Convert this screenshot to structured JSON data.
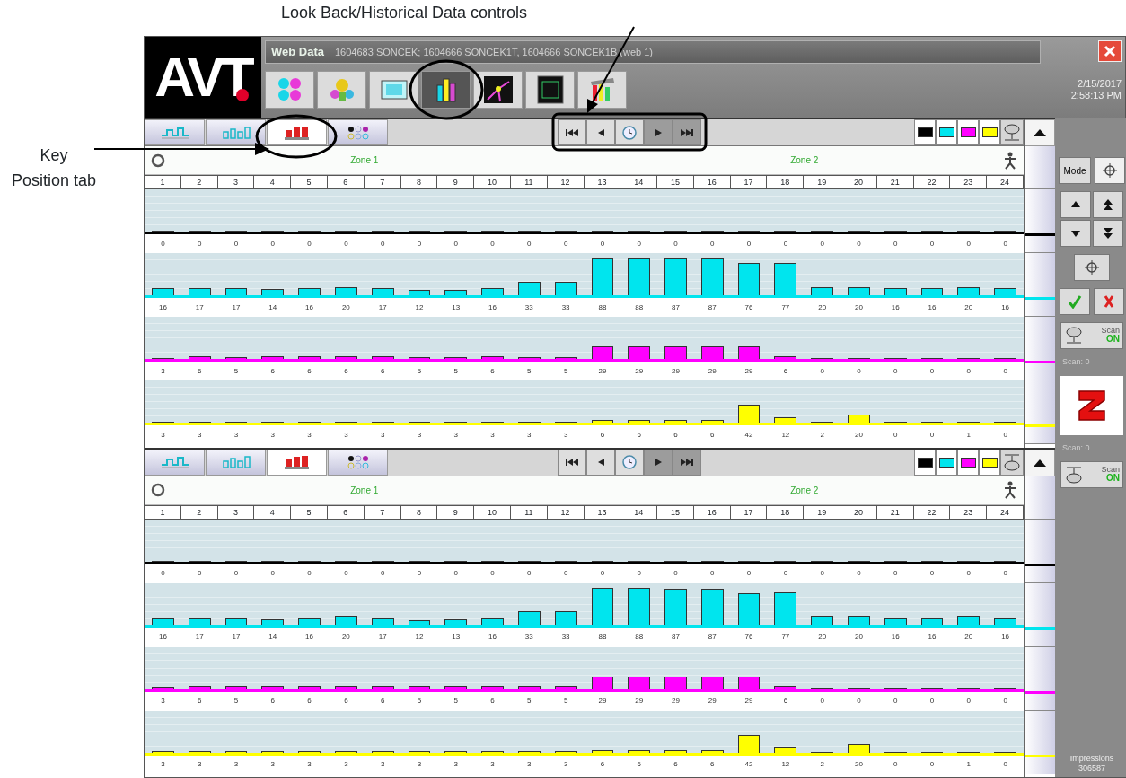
{
  "annotations": [
    {
      "kind": "top",
      "text": "Look Back/Historical Data controls"
    },
    {
      "kind": "left",
      "text": "Key Position tab"
    }
  ],
  "window": {
    "logo": "AVT",
    "app": "Web Data",
    "title": "1604683 SONCEK; 1604666 SONCEK1T, 1604666 SONCEK1B (web 1)",
    "date": "2/15/2017",
    "time": "2:58:13 PM"
  },
  "toolbar": [
    {
      "kind": "inks",
      "selected": false
    },
    {
      "kind": "flowers",
      "selected": false
    },
    {
      "kind": "film",
      "selected": false
    },
    {
      "kind": "bars",
      "selected": true
    },
    {
      "kind": "graph",
      "selected": false
    },
    {
      "kind": "frame",
      "selected": false
    },
    {
      "kind": "tools",
      "selected": false
    }
  ],
  "panels": [
    {
      "tabs": [
        {
          "kind": "line",
          "selected": false
        },
        {
          "kind": "outline",
          "selected": false
        },
        {
          "kind": "keys",
          "selected": true
        },
        {
          "kind": "dots",
          "selected": false
        }
      ],
      "nav": [
        {
          "kind": "first",
          "disabled": false
        },
        {
          "kind": "prev",
          "disabled": false
        },
        {
          "kind": "clock",
          "disabled": false
        },
        {
          "kind": "next",
          "disabled": true
        },
        {
          "kind": "last",
          "disabled": true
        }
      ],
      "swatches": [
        {
          "color": "#000000"
        },
        {
          "color": "#00e5ee"
        },
        {
          "color": "#ff00ff"
        },
        {
          "color": "#ffff00"
        }
      ],
      "key": {
        "kind": "top"
      },
      "zones": [
        "Zone 1",
        "Zone 2"
      ],
      "keys": [
        "1",
        "2",
        "3",
        "4",
        "5",
        "6",
        "7",
        "8",
        "9",
        "10",
        "11",
        "12",
        "13",
        "14",
        "15",
        "16",
        "17",
        "18",
        "19",
        "20",
        "21",
        "22",
        "23",
        "24"
      ],
      "lanes": [
        {
          "color": "#000000",
          "keys": [
            {
              "reading": "0",
              "level": 0
            },
            {
              "reading": "0",
              "level": 0
            },
            {
              "reading": "0",
              "level": 0
            },
            {
              "reading": "0",
              "level": 0
            },
            {
              "reading": "0",
              "level": 0
            },
            {
              "reading": "0",
              "level": 0
            },
            {
              "reading": "0",
              "level": 0
            },
            {
              "reading": "0",
              "level": 0
            },
            {
              "reading": "0",
              "level": 0
            },
            {
              "reading": "0",
              "level": 0
            },
            {
              "reading": "0",
              "level": 0
            },
            {
              "reading": "0",
              "level": 0
            },
            {
              "reading": "0",
              "level": 0
            },
            {
              "reading": "0",
              "level": 0
            },
            {
              "reading": "0",
              "level": 0
            },
            {
              "reading": "0",
              "level": 0
            },
            {
              "reading": "0",
              "level": 0
            },
            {
              "reading": "0",
              "level": 0
            },
            {
              "reading": "0",
              "level": 0
            },
            {
              "reading": "0",
              "level": 0
            },
            {
              "reading": "0",
              "level": 0
            },
            {
              "reading": "0",
              "level": 0
            },
            {
              "reading": "0",
              "level": 0
            },
            {
              "reading": "0",
              "level": 0
            }
          ]
        },
        {
          "color": "#00e5ee",
          "keys": [
            {
              "reading": "16",
              "level": 0.16
            },
            {
              "reading": "17",
              "level": 0.17
            },
            {
              "reading": "17",
              "level": 0.17
            },
            {
              "reading": "14",
              "level": 0.14
            },
            {
              "reading": "16",
              "level": 0.16
            },
            {
              "reading": "20",
              "level": 0.2
            },
            {
              "reading": "17",
              "level": 0.17
            },
            {
              "reading": "12",
              "level": 0.12
            },
            {
              "reading": "13",
              "level": 0.13
            },
            {
              "reading": "16",
              "level": 0.16
            },
            {
              "reading": "33",
              "level": 0.33
            },
            {
              "reading": "33",
              "level": 0.33
            },
            {
              "reading": "88",
              "level": 0.88
            },
            {
              "reading": "88",
              "level": 0.88
            },
            {
              "reading": "87",
              "level": 0.87
            },
            {
              "reading": "87",
              "level": 0.87
            },
            {
              "reading": "76",
              "level": 0.76
            },
            {
              "reading": "77",
              "level": 0.77
            },
            {
              "reading": "20",
              "level": 0.2
            },
            {
              "reading": "20",
              "level": 0.2
            },
            {
              "reading": "16",
              "level": 0.16
            },
            {
              "reading": "16",
              "level": 0.16
            },
            {
              "reading": "20",
              "level": 0.2
            },
            {
              "reading": "16",
              "level": 0.16
            }
          ]
        },
        {
          "color": "#ff00ff",
          "keys": [
            {
              "reading": "3",
              "level": 0.03
            },
            {
              "reading": "6",
              "level": 0.06
            },
            {
              "reading": "5",
              "level": 0.05
            },
            {
              "reading": "6",
              "level": 0.06
            },
            {
              "reading": "6",
              "level": 0.06
            },
            {
              "reading": "6",
              "level": 0.06
            },
            {
              "reading": "6",
              "level": 0.06
            },
            {
              "reading": "5",
              "level": 0.05
            },
            {
              "reading": "5",
              "level": 0.05
            },
            {
              "reading": "6",
              "level": 0.06
            },
            {
              "reading": "5",
              "level": 0.05
            },
            {
              "reading": "5",
              "level": 0.05
            },
            {
              "reading": "29",
              "level": 0.29
            },
            {
              "reading": "29",
              "level": 0.29
            },
            {
              "reading": "29",
              "level": 0.29
            },
            {
              "reading": "29",
              "level": 0.29
            },
            {
              "reading": "29",
              "level": 0.29
            },
            {
              "reading": "6",
              "level": 0.06
            },
            {
              "reading": "0",
              "level": 0
            },
            {
              "reading": "0",
              "level": 0
            },
            {
              "reading": "0",
              "level": 0
            },
            {
              "reading": "0",
              "level": 0
            },
            {
              "reading": "0",
              "level": 0
            },
            {
              "reading": "0",
              "level": 0
            }
          ]
        },
        {
          "color": "#ffff00",
          "keys": [
            {
              "reading": "3",
              "level": 0.03
            },
            {
              "reading": "3",
              "level": 0.03
            },
            {
              "reading": "3",
              "level": 0.03
            },
            {
              "reading": "3",
              "level": 0.03
            },
            {
              "reading": "3",
              "level": 0.03
            },
            {
              "reading": "3",
              "level": 0.03
            },
            {
              "reading": "3",
              "level": 0.03
            },
            {
              "reading": "3",
              "level": 0.03
            },
            {
              "reading": "3",
              "level": 0.03
            },
            {
              "reading": "3",
              "level": 0.03
            },
            {
              "reading": "3",
              "level": 0.03
            },
            {
              "reading": "3",
              "level": 0.03
            },
            {
              "reading": "6",
              "level": 0.06
            },
            {
              "reading": "6",
              "level": 0.06
            },
            {
              "reading": "6",
              "level": 0.06
            },
            {
              "reading": "6",
              "level": 0.06
            },
            {
              "reading": "42",
              "level": 0.42
            },
            {
              "reading": "12",
              "level": 0.12
            },
            {
              "reading": "2",
              "level": 0.02
            },
            {
              "reading": "20",
              "level": 0.2
            },
            {
              "reading": "0",
              "level": 0
            },
            {
              "reading": "0",
              "level": 0
            },
            {
              "reading": "1",
              "level": 0.01
            },
            {
              "reading": "0",
              "level": 0
            }
          ]
        }
      ]
    },
    {
      "tabs": [
        {
          "kind": "line",
          "selected": false
        },
        {
          "kind": "outline",
          "selected": false
        },
        {
          "kind": "keys",
          "selected": true
        },
        {
          "kind": "dots",
          "selected": false
        }
      ],
      "nav": [
        {
          "kind": "first",
          "disabled": false
        },
        {
          "kind": "prev",
          "disabled": false
        },
        {
          "kind": "clock",
          "disabled": false
        },
        {
          "kind": "next",
          "disabled": true
        },
        {
          "kind": "last",
          "disabled": true
        }
      ],
      "swatches": [
        {
          "color": "#000000"
        },
        {
          "color": "#00e5ee"
        },
        {
          "color": "#ff00ff"
        },
        {
          "color": "#ffff00"
        }
      ],
      "key": {
        "kind": "bottom"
      },
      "zones": [
        "Zone 1",
        "Zone 2"
      ],
      "keys": [
        "1",
        "2",
        "3",
        "4",
        "5",
        "6",
        "7",
        "8",
        "9",
        "10",
        "11",
        "12",
        "13",
        "14",
        "15",
        "16",
        "17",
        "18",
        "19",
        "20",
        "21",
        "22",
        "23",
        "24"
      ],
      "lanes": [
        {
          "color": "#000000",
          "keys": [
            {
              "reading": "0",
              "level": 0
            },
            {
              "reading": "0",
              "level": 0
            },
            {
              "reading": "0",
              "level": 0
            },
            {
              "reading": "0",
              "level": 0
            },
            {
              "reading": "0",
              "level": 0
            },
            {
              "reading": "0",
              "level": 0
            },
            {
              "reading": "0",
              "level": 0
            },
            {
              "reading": "0",
              "level": 0
            },
            {
              "reading": "0",
              "level": 0
            },
            {
              "reading": "0",
              "level": 0
            },
            {
              "reading": "0",
              "level": 0
            },
            {
              "reading": "0",
              "level": 0
            },
            {
              "reading": "0",
              "level": 0
            },
            {
              "reading": "0",
              "level": 0
            },
            {
              "reading": "0",
              "level": 0
            },
            {
              "reading": "0",
              "level": 0
            },
            {
              "reading": "0",
              "level": 0
            },
            {
              "reading": "0",
              "level": 0
            },
            {
              "reading": "0",
              "level": 0
            },
            {
              "reading": "0",
              "level": 0
            },
            {
              "reading": "0",
              "level": 0
            },
            {
              "reading": "0",
              "level": 0
            },
            {
              "reading": "0",
              "level": 0
            },
            {
              "reading": "0",
              "level": 0
            }
          ]
        },
        {
          "color": "#00e5ee",
          "keys": [
            {
              "reading": "16",
              "level": 0.16
            },
            {
              "reading": "17",
              "level": 0.17
            },
            {
              "reading": "17",
              "level": 0.17
            },
            {
              "reading": "14",
              "level": 0.14
            },
            {
              "reading": "16",
              "level": 0.16
            },
            {
              "reading": "20",
              "level": 0.2
            },
            {
              "reading": "17",
              "level": 0.17
            },
            {
              "reading": "12",
              "level": 0.12
            },
            {
              "reading": "13",
              "level": 0.13
            },
            {
              "reading": "16",
              "level": 0.16
            },
            {
              "reading": "33",
              "level": 0.33
            },
            {
              "reading": "33",
              "level": 0.33
            },
            {
              "reading": "88",
              "level": 0.88
            },
            {
              "reading": "88",
              "level": 0.88
            },
            {
              "reading": "87",
              "level": 0.87
            },
            {
              "reading": "87",
              "level": 0.87
            },
            {
              "reading": "76",
              "level": 0.76
            },
            {
              "reading": "77",
              "level": 0.77
            },
            {
              "reading": "20",
              "level": 0.2
            },
            {
              "reading": "20",
              "level": 0.2
            },
            {
              "reading": "16",
              "level": 0.16
            },
            {
              "reading": "16",
              "level": 0.16
            },
            {
              "reading": "20",
              "level": 0.2
            },
            {
              "reading": "16",
              "level": 0.16
            }
          ]
        },
        {
          "color": "#ff00ff",
          "keys": [
            {
              "reading": "3",
              "level": 0.03
            },
            {
              "reading": "6",
              "level": 0.06
            },
            {
              "reading": "5",
              "level": 0.05
            },
            {
              "reading": "6",
              "level": 0.06
            },
            {
              "reading": "6",
              "level": 0.06
            },
            {
              "reading": "6",
              "level": 0.06
            },
            {
              "reading": "6",
              "level": 0.06
            },
            {
              "reading": "5",
              "level": 0.05
            },
            {
              "reading": "5",
              "level": 0.05
            },
            {
              "reading": "6",
              "level": 0.06
            },
            {
              "reading": "5",
              "level": 0.05
            },
            {
              "reading": "5",
              "level": 0.05
            },
            {
              "reading": "29",
              "level": 0.29
            },
            {
              "reading": "29",
              "level": 0.29
            },
            {
              "reading": "29",
              "level": 0.29
            },
            {
              "reading": "29",
              "level": 0.29
            },
            {
              "reading": "29",
              "level": 0.29
            },
            {
              "reading": "6",
              "level": 0.06
            },
            {
              "reading": "0",
              "level": 0
            },
            {
              "reading": "0",
              "level": 0
            },
            {
              "reading": "0",
              "level": 0
            },
            {
              "reading": "0",
              "level": 0
            },
            {
              "reading": "0",
              "level": 0
            },
            {
              "reading": "0",
              "level": 0
            }
          ]
        },
        {
          "color": "#ffff00",
          "keys": [
            {
              "reading": "3",
              "level": 0.03
            },
            {
              "reading": "3",
              "level": 0.03
            },
            {
              "reading": "3",
              "level": 0.03
            },
            {
              "reading": "3",
              "level": 0.03
            },
            {
              "reading": "3",
              "level": 0.03
            },
            {
              "reading": "3",
              "level": 0.03
            },
            {
              "reading": "3",
              "level": 0.03
            },
            {
              "reading": "3",
              "level": 0.03
            },
            {
              "reading": "3",
              "level": 0.03
            },
            {
              "reading": "3",
              "level": 0.03
            },
            {
              "reading": "3",
              "level": 0.03
            },
            {
              "reading": "3",
              "level": 0.03
            },
            {
              "reading": "6",
              "level": 0.06
            },
            {
              "reading": "6",
              "level": 0.06
            },
            {
              "reading": "6",
              "level": 0.06
            },
            {
              "reading": "6",
              "level": 0.06
            },
            {
              "reading": "42",
              "level": 0.42
            },
            {
              "reading": "12",
              "level": 0.12
            },
            {
              "reading": "2",
              "level": 0.02
            },
            {
              "reading": "20",
              "level": 0.2
            },
            {
              "reading": "0",
              "level": 0
            },
            {
              "reading": "0",
              "level": 0
            },
            {
              "reading": "1",
              "level": 0.01
            },
            {
              "reading": "0",
              "level": 0
            }
          ]
        }
      ]
    }
  ],
  "side": {
    "mode": "Mode",
    "scan_top": {
      "label": "Scan",
      "state": "ON",
      "on": true
    },
    "reading_top": "Scan: 0",
    "reading_bottom": "Scan: 0",
    "scan_bottom": {
      "label": "Scan",
      "state": "ON",
      "on": true
    },
    "impressions_label": "Impressions",
    "impressions": "306587"
  }
}
